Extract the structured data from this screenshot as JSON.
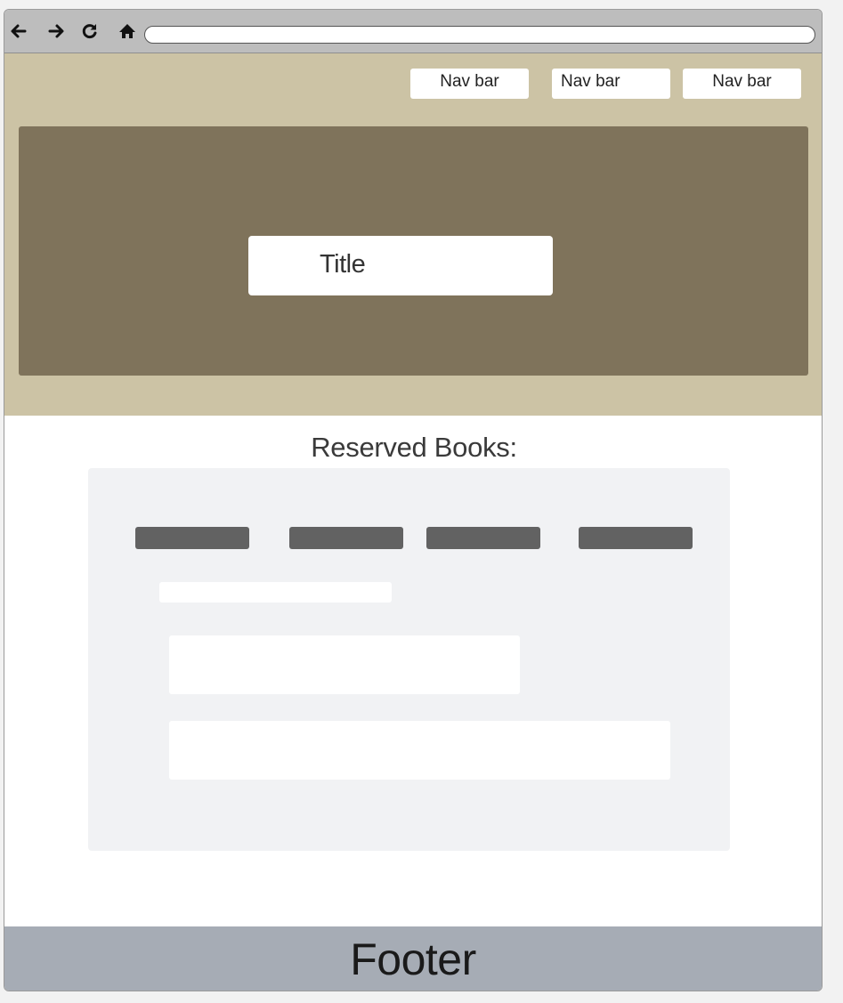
{
  "browser": {
    "icons": [
      "back-arrow-icon",
      "forward-arrow-icon",
      "reload-icon",
      "home-icon"
    ],
    "address_value": ""
  },
  "header": {
    "nav": [
      {
        "label": "Nav bar"
      },
      {
        "label": "Nav bar"
      },
      {
        "label": "Nav bar"
      }
    ],
    "title": "Title"
  },
  "main": {
    "heading": "Reserved Books:"
  },
  "footer": {
    "label": "Footer"
  },
  "colors": {
    "header_bg": "#ccc3a5",
    "hero_bg": "#7f735b",
    "panel_bg": "#f1f2f4",
    "tab_bar": "#626262",
    "footer_bg": "#a6acb5",
    "browser_bar": "#bdbdbd"
  }
}
